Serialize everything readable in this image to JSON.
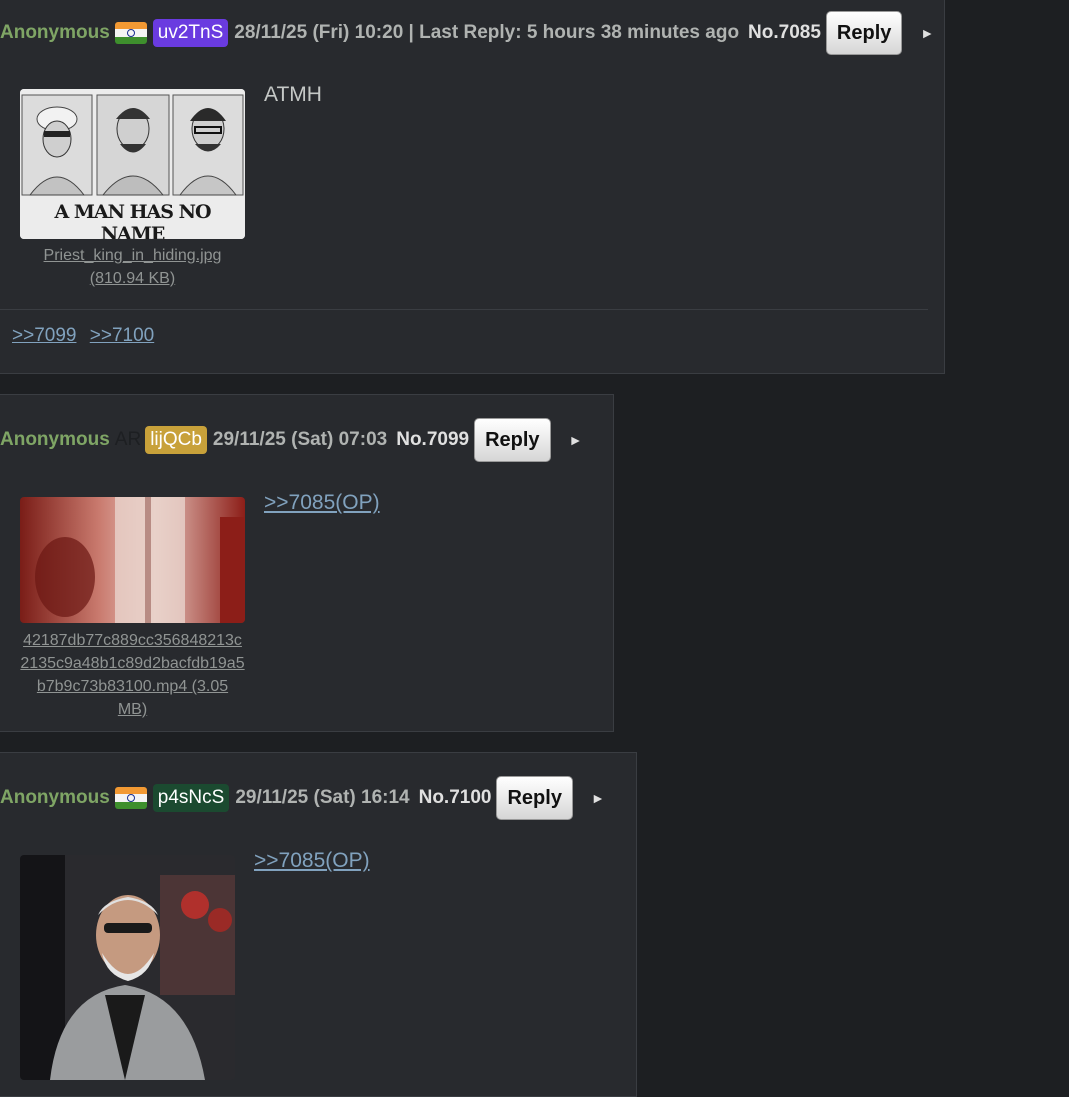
{
  "posts": [
    {
      "name": "Anonymous",
      "flag": "india-flag",
      "poster_id": "uv2TnS",
      "poster_id_color": "#6a3be0",
      "date": "28/11/25 (Fri) 10:20 | Last Reply: 5 hours 38 minutes ago",
      "post_no": "No.7085",
      "reply_label": "Reply",
      "menu_icon": "►",
      "file_name": "Priest_king_in_hiding.jpg",
      "file_size": "(810.94 KB)",
      "thumb_caption": "A MAN HAS NO NAME",
      "body": "ATMH",
      "backlinks": [
        ">>7099",
        ">>7100"
      ]
    },
    {
      "name": "Anonymous",
      "country_code": "AR",
      "poster_id": "lijQCb",
      "poster_id_color": "#c8a13a",
      "date": "29/11/25 (Sat) 07:03",
      "post_no": "No.7099",
      "reply_label": "Reply",
      "menu_icon": "►",
      "file_name_line1": "42187db77c889cc356848213c",
      "file_name_line2": "2135c9a48b1c89d2bacfdb19a5",
      "file_name_line3": "b7b9c73b83100.mp4 (3.05 MB)",
      "quote": ">>7085(OP)"
    },
    {
      "name": "Anonymous",
      "flag": "india-flag",
      "poster_id": "p4sNcS",
      "poster_id_color": "#1b4a30",
      "date": "29/11/25 (Sat) 16:14",
      "post_no": "No.7100",
      "reply_label": "Reply",
      "menu_icon": "►",
      "quote": ">>7085(OP)"
    }
  ]
}
